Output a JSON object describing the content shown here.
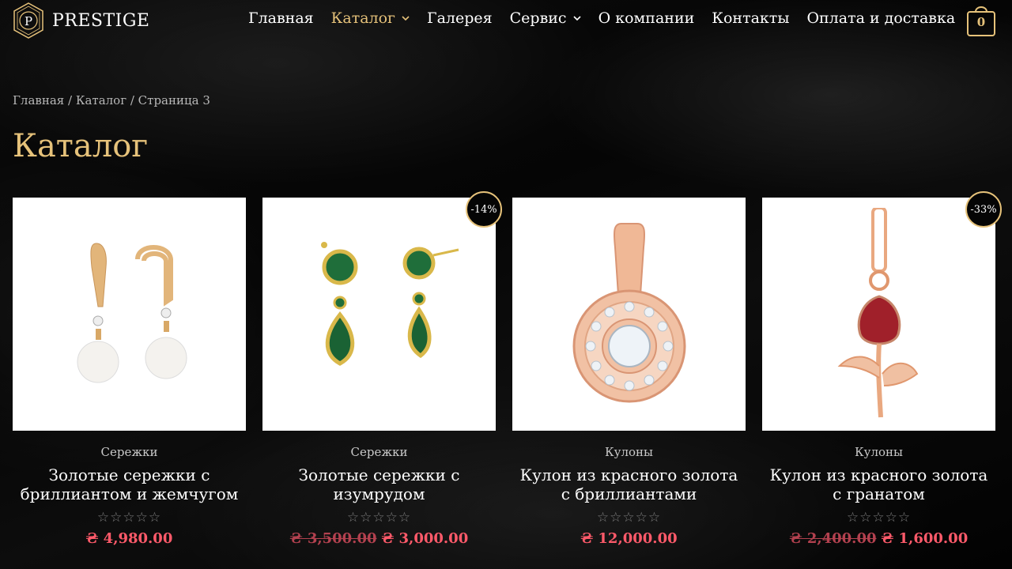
{
  "brand": {
    "name": "PRESTIGE"
  },
  "nav": {
    "items": [
      {
        "label": "Главная"
      },
      {
        "label": "Каталог"
      },
      {
        "label": "Галерея"
      },
      {
        "label": "Сервис"
      },
      {
        "label": "О компании"
      },
      {
        "label": "Контакты"
      },
      {
        "label": "Оплата и доставка"
      }
    ]
  },
  "cart": {
    "count": "0"
  },
  "breadcrumb": {
    "home": "Главная",
    "sep1": " / ",
    "catalog": "Каталог",
    "sep2": " / ",
    "current": "Страница 3"
  },
  "page": {
    "title": "Каталог"
  },
  "products": [
    {
      "category": "Сережки",
      "title": "Золотые сережки с бриллиантом и жемчугом",
      "stars": "☆☆☆☆☆",
      "price": "₴ 4,980.00",
      "old_price": "",
      "badge": ""
    },
    {
      "category": "Сережки",
      "title": "Золотые сережки с изумрудом",
      "stars": "☆☆☆☆☆",
      "price": "₴ 3,000.00",
      "old_price": "₴ 3,500.00",
      "badge": "-14%"
    },
    {
      "category": "Кулоны",
      "title": "Кулон из красного золота с бриллиантами",
      "stars": "☆☆☆☆☆",
      "price": "₴ 12,000.00",
      "old_price": "",
      "badge": ""
    },
    {
      "category": "Кулоны",
      "title": "Кулон из красного золота с гранатом",
      "stars": "☆☆☆☆☆",
      "price": "₴ 1,600.00",
      "old_price": "₴ 2,400.00",
      "badge": "-33%"
    }
  ],
  "colors": {
    "accent": "#e6c27a",
    "price": "#ff5a6a",
    "old_price": "#b3414f"
  }
}
